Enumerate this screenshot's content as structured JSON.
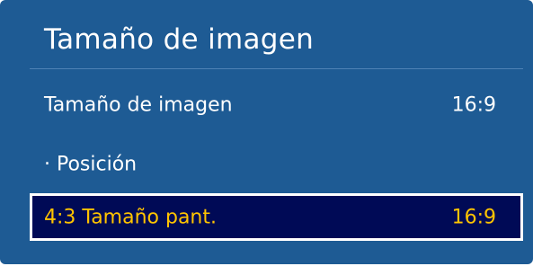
{
  "menu": {
    "title": "Tamaño de imagen",
    "items": [
      {
        "label": "Tamaño de imagen",
        "value": "16:9",
        "selected": false
      },
      {
        "label": "· Posición",
        "value": "",
        "selected": false
      },
      {
        "label": "4:3 Tamaño pant.",
        "value": "16:9",
        "selected": true
      }
    ]
  },
  "colors": {
    "panel_background": "#1e5b94",
    "text": "#ffffff",
    "highlight_background": "#000a56",
    "highlight_border": "#ffffff",
    "highlight_text": "#ffc400"
  }
}
